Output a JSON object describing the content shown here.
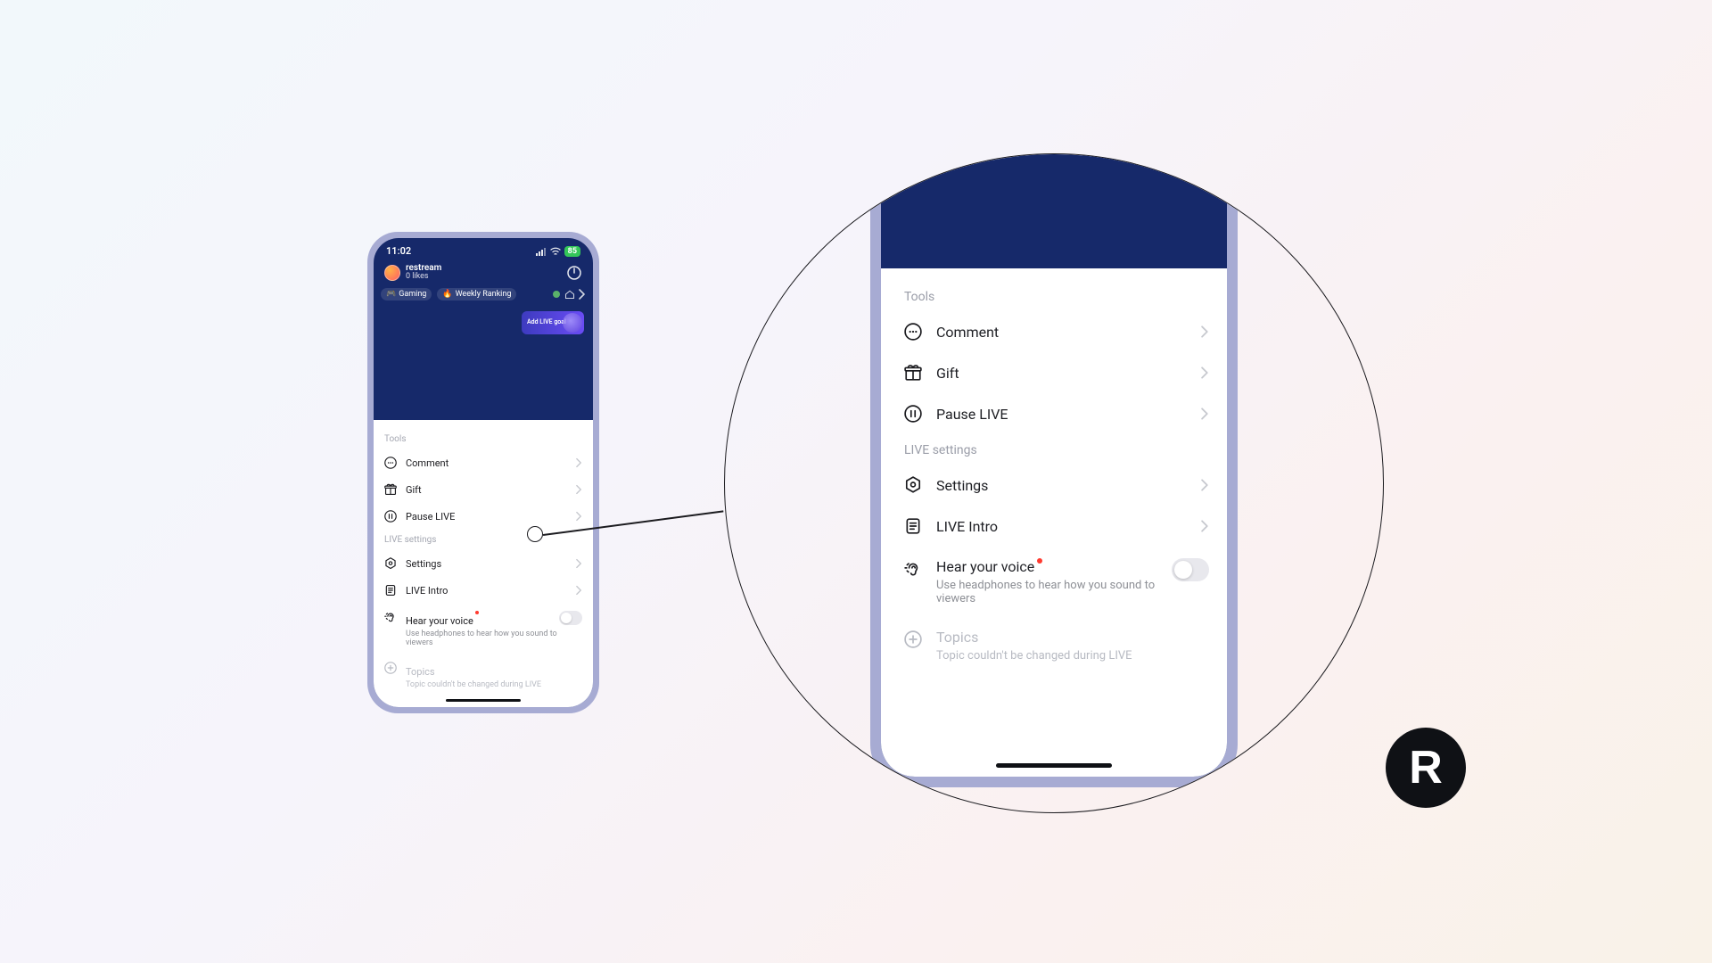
{
  "statusbar": {
    "time": "11:02",
    "battery": "85"
  },
  "profile": {
    "username": "restream",
    "likes": "0 likes"
  },
  "chips": {
    "gaming": "Gaming",
    "ranking": "Weekly Ranking"
  },
  "live_goal": "Add LIVE goal",
  "sections": {
    "tools_title": "Tools",
    "settings_title": "LIVE settings"
  },
  "tools": {
    "comment": "Comment",
    "gift": "Gift",
    "pause": "Pause LIVE"
  },
  "settings": {
    "settings": "Settings",
    "intro": "LIVE Intro",
    "hear_voice": "Hear your voice",
    "hear_voice_sub": "Use headphones to hear how you sound to viewers",
    "topics": "Topics",
    "topics_sub": "Topic couldn't be changed during LIVE"
  },
  "logo": "R"
}
